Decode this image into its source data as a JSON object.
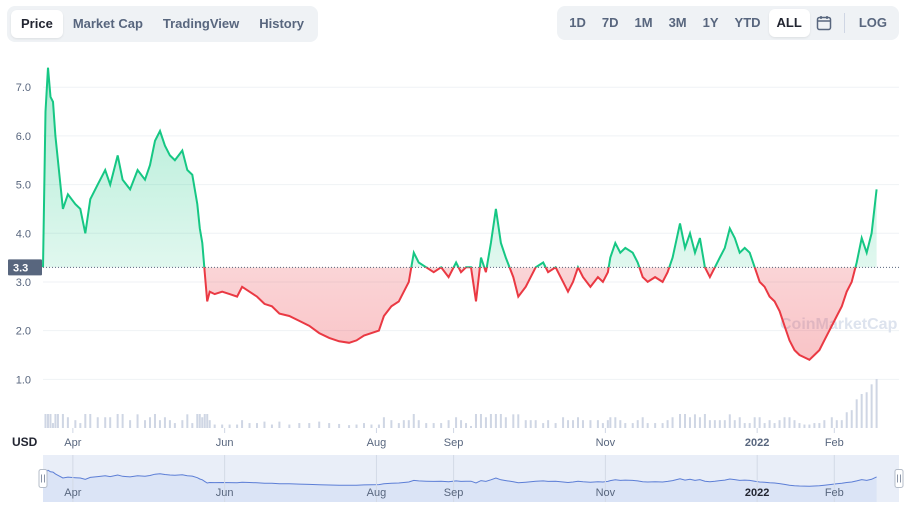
{
  "tabs": [
    {
      "label": "Price",
      "active": true
    },
    {
      "label": "Market Cap",
      "active": false
    },
    {
      "label": "TradingView",
      "active": false
    },
    {
      "label": "History",
      "active": false
    }
  ],
  "ranges": [
    {
      "label": "1D",
      "active": false
    },
    {
      "label": "7D",
      "active": false
    },
    {
      "label": "1M",
      "active": false
    },
    {
      "label": "3M",
      "active": false
    },
    {
      "label": "1Y",
      "active": false
    },
    {
      "label": "YTD",
      "active": false
    },
    {
      "label": "ALL",
      "active": true
    }
  ],
  "log_label": "LOG",
  "calendar_icon": "calendar-icon",
  "currency_label": "USD",
  "watermark": "CoinMarketCap",
  "colors": {
    "up": "#16c784",
    "down": "#ea3943",
    "reference": "#58667e",
    "navigator_line": "#5c7ed6",
    "navigator_fill": "#dbe4f6",
    "volume": "#cfd6e4"
  },
  "chart_data": {
    "type": "area",
    "title": "",
    "xlabel": "",
    "ylabel": "USD",
    "reference_line": {
      "value": 3.3,
      "label": "3.3"
    },
    "ylim": [
      0,
      7.6
    ],
    "yticks": [
      "1.0",
      "2.0",
      "3.0",
      "4.0",
      "5.0",
      "6.0",
      "7.0"
    ],
    "xlim": [
      "2021-03-20",
      "2022-02-27"
    ],
    "xticks": [
      {
        "date": "2021-04-01",
        "label": "Apr",
        "bold": false
      },
      {
        "date": "2021-06-01",
        "label": "Jun",
        "bold": false
      },
      {
        "date": "2021-08-01",
        "label": "Aug",
        "bold": false
      },
      {
        "date": "2021-09-01",
        "label": "Sep",
        "bold": false
      },
      {
        "date": "2021-11-01",
        "label": "Nov",
        "bold": false
      },
      {
        "date": "2022-01-01",
        "label": "2022",
        "bold": true
      },
      {
        "date": "2022-02-01",
        "label": "Feb",
        "bold": false
      }
    ],
    "series": [
      {
        "values": [
          [
            "2021-03-20",
            3.3
          ],
          [
            "2021-03-21",
            6.5
          ],
          [
            "2021-03-22",
            7.4
          ],
          [
            "2021-03-23",
            6.8
          ],
          [
            "2021-03-24",
            6.7
          ],
          [
            "2021-03-25",
            6.0
          ],
          [
            "2021-03-26",
            5.5
          ],
          [
            "2021-03-28",
            4.5
          ],
          [
            "2021-03-30",
            4.8
          ],
          [
            "2021-04-02",
            4.6
          ],
          [
            "2021-04-04",
            4.5
          ],
          [
            "2021-04-06",
            4.0
          ],
          [
            "2021-04-08",
            4.7
          ],
          [
            "2021-04-11",
            5.0
          ],
          [
            "2021-04-14",
            5.3
          ],
          [
            "2021-04-16",
            5.0
          ],
          [
            "2021-04-19",
            5.6
          ],
          [
            "2021-04-21",
            5.1
          ],
          [
            "2021-04-24",
            4.9
          ],
          [
            "2021-04-27",
            5.3
          ],
          [
            "2021-04-30",
            5.1
          ],
          [
            "2021-05-02",
            5.4
          ],
          [
            "2021-05-04",
            5.9
          ],
          [
            "2021-05-06",
            6.1
          ],
          [
            "2021-05-08",
            5.8
          ],
          [
            "2021-05-10",
            5.6
          ],
          [
            "2021-05-12",
            5.5
          ],
          [
            "2021-05-15",
            5.7
          ],
          [
            "2021-05-17",
            5.3
          ],
          [
            "2021-05-19",
            5.2
          ],
          [
            "2021-05-21",
            4.6
          ],
          [
            "2021-05-22",
            4.1
          ],
          [
            "2021-05-23",
            3.8
          ],
          [
            "2021-05-24",
            3.2
          ],
          [
            "2021-05-25",
            2.6
          ],
          [
            "2021-05-26",
            2.8
          ],
          [
            "2021-05-28",
            2.75
          ],
          [
            "2021-05-31",
            2.8
          ],
          [
            "2021-06-03",
            2.75
          ],
          [
            "2021-06-06",
            2.7
          ],
          [
            "2021-06-08",
            2.9
          ],
          [
            "2021-06-11",
            2.8
          ],
          [
            "2021-06-14",
            2.7
          ],
          [
            "2021-06-17",
            2.55
          ],
          [
            "2021-06-20",
            2.5
          ],
          [
            "2021-06-23",
            2.35
          ],
          [
            "2021-06-27",
            2.3
          ],
          [
            "2021-07-01",
            2.2
          ],
          [
            "2021-07-05",
            2.1
          ],
          [
            "2021-07-09",
            1.95
          ],
          [
            "2021-07-13",
            1.85
          ],
          [
            "2021-07-17",
            1.78
          ],
          [
            "2021-07-21",
            1.75
          ],
          [
            "2021-07-24",
            1.8
          ],
          [
            "2021-07-27",
            1.9
          ],
          [
            "2021-07-30",
            1.95
          ],
          [
            "2021-08-02",
            2.0
          ],
          [
            "2021-08-04",
            2.3
          ],
          [
            "2021-08-07",
            2.5
          ],
          [
            "2021-08-10",
            2.6
          ],
          [
            "2021-08-12",
            2.8
          ],
          [
            "2021-08-14",
            3.0
          ],
          [
            "2021-08-16",
            3.6
          ],
          [
            "2021-08-18",
            3.4
          ],
          [
            "2021-08-21",
            3.3
          ],
          [
            "2021-08-24",
            3.2
          ],
          [
            "2021-08-27",
            3.3
          ],
          [
            "2021-08-30",
            3.1
          ],
          [
            "2021-09-02",
            3.4
          ],
          [
            "2021-09-04",
            3.2
          ],
          [
            "2021-09-06",
            3.3
          ],
          [
            "2021-09-08",
            3.3
          ],
          [
            "2021-09-10",
            2.6
          ],
          [
            "2021-09-12",
            3.5
          ],
          [
            "2021-09-14",
            3.2
          ],
          [
            "2021-09-16",
            3.8
          ],
          [
            "2021-09-18",
            4.5
          ],
          [
            "2021-09-20",
            3.8
          ],
          [
            "2021-09-22",
            3.5
          ],
          [
            "2021-09-25",
            3.1
          ],
          [
            "2021-09-27",
            2.7
          ],
          [
            "2021-09-30",
            2.9
          ],
          [
            "2021-10-02",
            3.1
          ],
          [
            "2021-10-04",
            3.3
          ],
          [
            "2021-10-07",
            3.4
          ],
          [
            "2021-10-09",
            3.2
          ],
          [
            "2021-10-12",
            3.3
          ],
          [
            "2021-10-15",
            3.0
          ],
          [
            "2021-10-17",
            2.8
          ],
          [
            "2021-10-19",
            3.0
          ],
          [
            "2021-10-21",
            3.3
          ],
          [
            "2021-10-23",
            3.1
          ],
          [
            "2021-10-26",
            2.9
          ],
          [
            "2021-10-29",
            3.1
          ],
          [
            "2021-10-31",
            3.0
          ],
          [
            "2021-11-02",
            3.2
          ],
          [
            "2021-11-03",
            3.5
          ],
          [
            "2021-11-05",
            3.8
          ],
          [
            "2021-11-07",
            3.6
          ],
          [
            "2021-11-09",
            3.7
          ],
          [
            "2021-11-12",
            3.6
          ],
          [
            "2021-11-14",
            3.4
          ],
          [
            "2021-11-16",
            3.1
          ],
          [
            "2021-11-18",
            3.0
          ],
          [
            "2021-11-21",
            3.1
          ],
          [
            "2021-11-24",
            3.0
          ],
          [
            "2021-11-26",
            3.2
          ],
          [
            "2021-11-28",
            3.5
          ],
          [
            "2021-12-01",
            4.2
          ],
          [
            "2021-12-03",
            3.7
          ],
          [
            "2021-12-05",
            4.0
          ],
          [
            "2021-12-07",
            3.6
          ],
          [
            "2021-12-09",
            3.9
          ],
          [
            "2021-12-11",
            3.3
          ],
          [
            "2021-12-13",
            3.1
          ],
          [
            "2021-12-15",
            3.3
          ],
          [
            "2021-12-17",
            3.5
          ],
          [
            "2021-12-19",
            3.7
          ],
          [
            "2021-12-21",
            4.1
          ],
          [
            "2021-12-23",
            3.9
          ],
          [
            "2021-12-25",
            3.6
          ],
          [
            "2021-12-27",
            3.7
          ],
          [
            "2021-12-29",
            3.6
          ],
          [
            "2021-12-31",
            3.3
          ],
          [
            "2022-01-02",
            3.0
          ],
          [
            "2022-01-04",
            2.9
          ],
          [
            "2022-01-06",
            2.7
          ],
          [
            "2022-01-08",
            2.6
          ],
          [
            "2022-01-10",
            2.4
          ],
          [
            "2022-01-12",
            2.1
          ],
          [
            "2022-01-14",
            1.8
          ],
          [
            "2022-01-16",
            1.6
          ],
          [
            "2022-01-18",
            1.5
          ],
          [
            "2022-01-20",
            1.45
          ],
          [
            "2022-01-22",
            1.4
          ],
          [
            "2022-01-24",
            1.5
          ],
          [
            "2022-01-26",
            1.6
          ],
          [
            "2022-01-28",
            1.8
          ],
          [
            "2022-01-31",
            2.1
          ],
          [
            "2022-02-02",
            2.3
          ],
          [
            "2022-02-04",
            2.5
          ],
          [
            "2022-02-06",
            2.8
          ],
          [
            "2022-02-08",
            3.0
          ],
          [
            "2022-02-10",
            3.4
          ],
          [
            "2022-02-12",
            3.9
          ],
          [
            "2022-02-14",
            3.6
          ],
          [
            "2022-02-16",
            4.0
          ],
          [
            "2022-02-18",
            4.9
          ]
        ]
      }
    ]
  }
}
